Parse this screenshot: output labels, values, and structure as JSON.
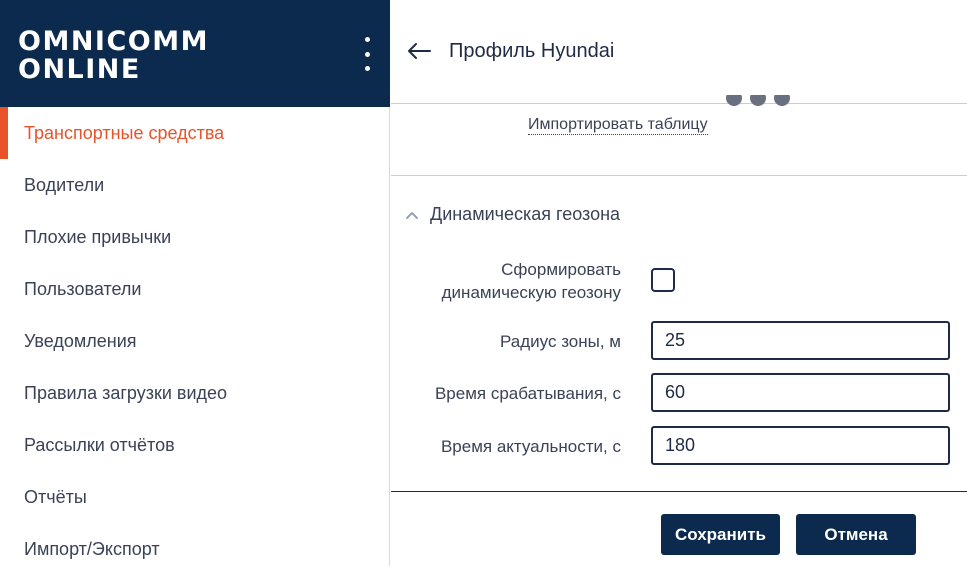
{
  "brand": {
    "line1": "OMNICOMM",
    "line2": "ONLINE"
  },
  "sidebar": {
    "items": [
      {
        "label": "Транспортные средства",
        "active": true
      },
      {
        "label": "Водители"
      },
      {
        "label": "Плохие привычки"
      },
      {
        "label": "Пользователи"
      },
      {
        "label": "Уведомления"
      },
      {
        "label": "Правила загрузки видео"
      },
      {
        "label": "Рассылки отчётов"
      },
      {
        "label": "Отчёты"
      },
      {
        "label": "Импорт/Экспорт"
      }
    ]
  },
  "header": {
    "title": "Профиль Hyundai"
  },
  "import": {
    "link_label": "Импортировать таблицу"
  },
  "geozone": {
    "section_title": "Динамическая геозона",
    "create_label": "Сформировать динамическую геозону",
    "create_checked": false,
    "radius_label": "Радиус зоны, м",
    "radius_value": "25",
    "trigger_label": "Время срабатывания, с",
    "trigger_value": "60",
    "relevance_label": "Время актуальности, с",
    "relevance_value": "180"
  },
  "actions": {
    "save_label": "Сохранить",
    "cancel_label": "Отмена"
  },
  "colors": {
    "brand_bg": "#0c2a4e",
    "accent": "#e9532a",
    "text": "#3a4256"
  },
  "icons": {
    "menu": "kebab-icon",
    "back": "arrow-left-icon",
    "collapse": "chevron-up-icon"
  }
}
